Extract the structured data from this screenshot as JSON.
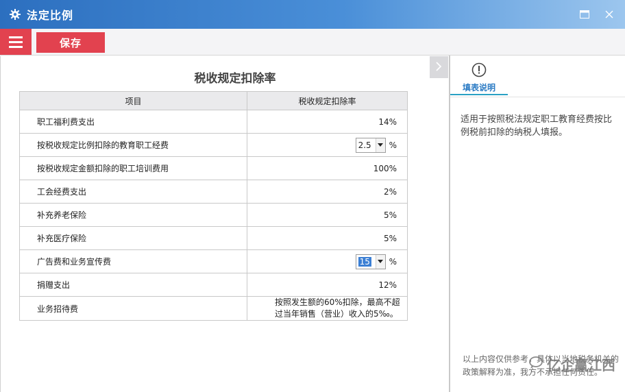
{
  "window": {
    "title": "法定比例"
  },
  "toolbar": {
    "save_label": "保存"
  },
  "main": {
    "title": "税收规定扣除率",
    "headers": [
      "项目",
      "税收规定扣除率"
    ],
    "rows": [
      {
        "item": "职工福利费支出",
        "value": "14%"
      },
      {
        "item": "按税收规定比例扣除的教育职工经费",
        "select": "2.5",
        "unit": "%"
      },
      {
        "item": "按税收规定金额扣除的职工培训费用",
        "value": "100%"
      },
      {
        "item": "工会经费支出",
        "value": "2%"
      },
      {
        "item": "补充养老保险",
        "value": "5%"
      },
      {
        "item": "补充医疗保险",
        "value": "5%"
      },
      {
        "item": "广告费和业务宣传费",
        "select": "15",
        "unit": "%"
      },
      {
        "item": "捐赠支出",
        "value": "12%"
      },
      {
        "item": "业务招待费",
        "note": "按照发生额的60%扣除，最高不超过当年销售（营业）收入的5‰。"
      }
    ]
  },
  "side": {
    "tab_label": "填表说明",
    "description": "适用于按照税法规定职工教育经费按比例税前扣除的纳税人填报。",
    "footer": "以上内容仅供参考，具体以当地税务机关的政策解释为准，我方不承担任何责任。"
  },
  "watermark": "亿企赢江西",
  "colors": {
    "accent": "#e2424f",
    "title_bar": "#2c6fbf",
    "tab_underline": "#2aa1c4"
  }
}
